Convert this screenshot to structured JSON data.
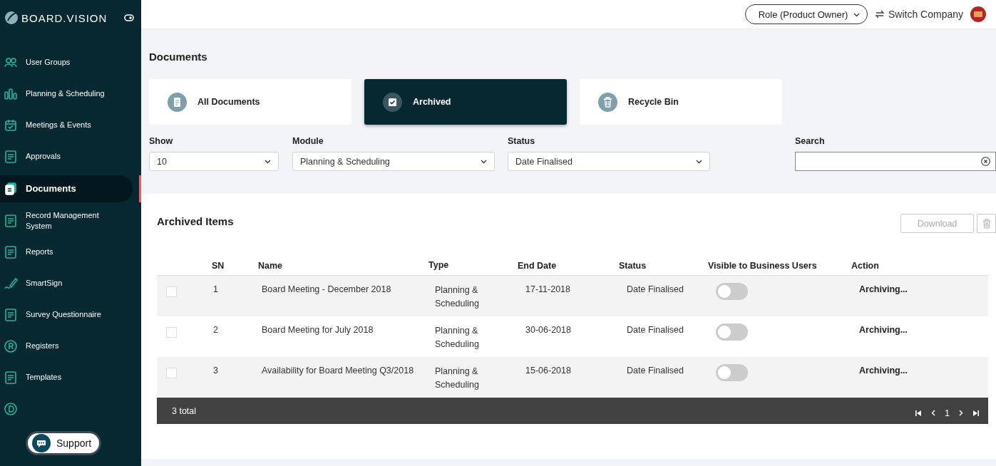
{
  "brand": {
    "name": "BOARD.VISION"
  },
  "sidebar": {
    "items": [
      {
        "label": "User Groups",
        "selected": false
      },
      {
        "label": "Planning & Scheduling",
        "selected": false
      },
      {
        "label": "Meetings & Events",
        "selected": false
      },
      {
        "label": "Approvals",
        "selected": false
      },
      {
        "label": "Documents",
        "selected": true
      },
      {
        "label": "Record Management System",
        "selected": false
      },
      {
        "label": "Reports",
        "selected": false
      },
      {
        "label": "SmartSign",
        "selected": false
      },
      {
        "label": "Survey Questionnaire",
        "selected": false
      },
      {
        "label": "Registers",
        "selected": false
      },
      {
        "label": "Templates",
        "selected": false
      }
    ]
  },
  "support": {
    "label": "Support"
  },
  "header": {
    "role": "Role (Product Owner)",
    "switch": "Switch Company"
  },
  "page_title": "Documents",
  "tabs": [
    {
      "label": "All Documents",
      "selected": false
    },
    {
      "label": "Archived",
      "selected": true
    },
    {
      "label": "Recycle Bin",
      "selected": false
    }
  ],
  "filters": [
    {
      "label": "Show",
      "value": "10"
    },
    {
      "label": "Module",
      "value": "Planning & Scheduling"
    },
    {
      "label": "Status",
      "value": "Date Finalised"
    }
  ],
  "search": {
    "label": "Search"
  },
  "table": {
    "title": "Archived Items",
    "download": "Download",
    "columns": [
      "SN",
      "Name",
      "Type",
      "End Date",
      "Status",
      "Visible to Business Users",
      "Action"
    ],
    "rows": [
      {
        "checked": false,
        "sn": "1",
        "name": "Board Meeting - December 2018",
        "type": "Planning & Scheduling",
        "end": "17-11-2018",
        "status": "Date Finalised",
        "visible": false,
        "action": "Archiving..."
      },
      {
        "checked": false,
        "sn": "2",
        "name": "Board Meeting for July 2018",
        "type": "Planning & Scheduling",
        "end": "30-06-2018",
        "status": "Date Finalised",
        "visible": false,
        "action": "Archiving..."
      },
      {
        "checked": false,
        "sn": "3",
        "name": "Availability for Board Meeting Q3/2018",
        "type": "Planning & Scheduling",
        "end": "15-06-2018",
        "status": "Date Finalised",
        "visible": false,
        "action": "Archiving..."
      }
    ],
    "total": "3 total",
    "page": "1"
  }
}
